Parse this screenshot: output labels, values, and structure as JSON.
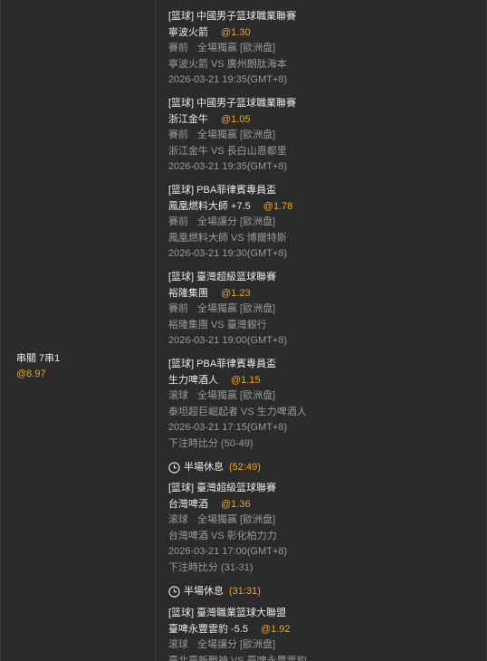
{
  "summary": {
    "type": "串關 7串1",
    "odds": "@8.97"
  },
  "bets": [
    {
      "league": "[篮球] 中國男子篮球職業聯賽",
      "selection": "寧波火箭",
      "odds": "@1.30",
      "period": "賽前",
      "market": "全場獨赢 [歐洲盘]",
      "match": "寧波火箭 VS 廣州朗肽海本",
      "time": "2026-03-21 19:35(GMT+8)"
    },
    {
      "league": "[篮球] 中國男子篮球職業聯賽",
      "selection": "浙江金牛",
      "odds": "@1.05",
      "period": "賽前",
      "market": "全場獨赢 [歐洲盘]",
      "match": "浙江金牛 VS 長白山恩都里",
      "time": "2026-03-21 19:35(GMT+8)"
    },
    {
      "league": "[篮球] PBA菲律賓專員盃",
      "selection": "鳳凰燃料大師 +7.5",
      "odds": "@1.78",
      "period": "賽前",
      "market": "全場讓分 [歐洲盘]",
      "match": "鳳凰燃料大師 VS 博爾特斯",
      "time": "2026-03-21 19:30(GMT+8)"
    },
    {
      "league": "[篮球] 臺灣超級篮球聯賽",
      "selection": "裕隆集團",
      "odds": "@1.23",
      "period": "賽前",
      "market": "全場獨赢 [歐洲盘]",
      "match": "裕隆集團 VS 臺灣銀行",
      "time": "2026-03-21 19:00(GMT+8)"
    },
    {
      "league": "[篮球] PBA菲律賓專員盃",
      "selection": "生力啤酒人",
      "odds": "@1.15",
      "period": "滚球",
      "market": "全場獨赢 [歐洲盘]",
      "match": "泰坦超巨崛起者 VS 生力啤酒人",
      "time": "2026-03-21 17:15(GMT+8)",
      "bet_score": "下注時比分 (50-49)",
      "status_label": "半場休息",
      "status_score": "(52:49)"
    },
    {
      "league": "[篮球] 臺灣超級篮球聯賽",
      "selection": "台灣啤酒",
      "odds": "@1.36",
      "period": "滚球",
      "market": "全場獨赢 [歐洲盘]",
      "match": "台灣啤酒 VS 彰化柏力力",
      "time": "2026-03-21 17:00(GMT+8)",
      "bet_score": "下注時比分 (31-31)",
      "status_label": "半場休息",
      "status_score": "(31:31)"
    },
    {
      "league": "[篮球] 臺灣職業篮球大聯盟",
      "selection": "臺啤永豐雲豹 -5.5",
      "odds": "@1.92",
      "period": "滚球",
      "market": "全場讓分 [歐洲盘]",
      "match": "臺北臺新戰神 VS 臺啤永豐雲豹"
    }
  ],
  "icons": {
    "status": "clock-icon"
  },
  "colors": {
    "accent": "#f0a41d",
    "muted": "#9a9a9a",
    "background": "#2b2b2b"
  }
}
